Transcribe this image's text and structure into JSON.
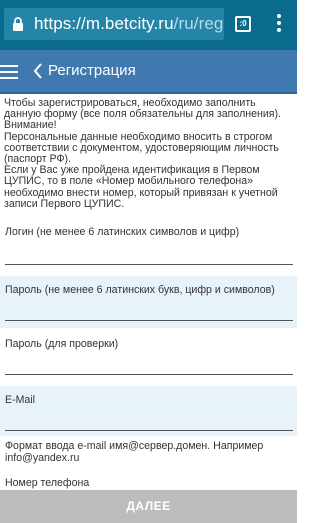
{
  "browser": {
    "url_host": "https://m.betcity.ru",
    "url_path": "/ru/reg",
    "tabs_label": ":0"
  },
  "appbar": {
    "title": "Регистрация"
  },
  "intro": {
    "lines": [
      "Чтобы зарегистрироваться, необходимо заполнить данную форму (все поля обязательны для заполнения).",
      "Внимание!",
      "Персональные данные необходимо вносить в строгом соответствии с документом, удостоверяющим личность (паспорт РФ).",
      "Если у Вас уже пройдена идентификация в Первом ЦУПИС, то в поле «Номер мобильного телефона» необходимо внести номер, который привязан к учетной записи Первого ЦУПИС."
    ]
  },
  "form": {
    "login_label": "Логин (не менее 6 латинских символов и цифр)",
    "password_label": "Пароль (не менее 6 латинских букв, цифр и символов)",
    "password_check_label": "Пароль (для проверки)",
    "email_label": "E-Mail",
    "email_hint": "Формат ввода e-mail имя@сервер.домен. Например\ninfo@yandex.ru",
    "phone_label": "Номер телефона"
  },
  "submit_label": "ДАЛЕЕ",
  "colors": {
    "urlbar": "#0b6b8f",
    "appbar": "#3f79b0",
    "field_alt_bg": "#e8f2f9",
    "submit_bg": "#bcbcbc"
  }
}
